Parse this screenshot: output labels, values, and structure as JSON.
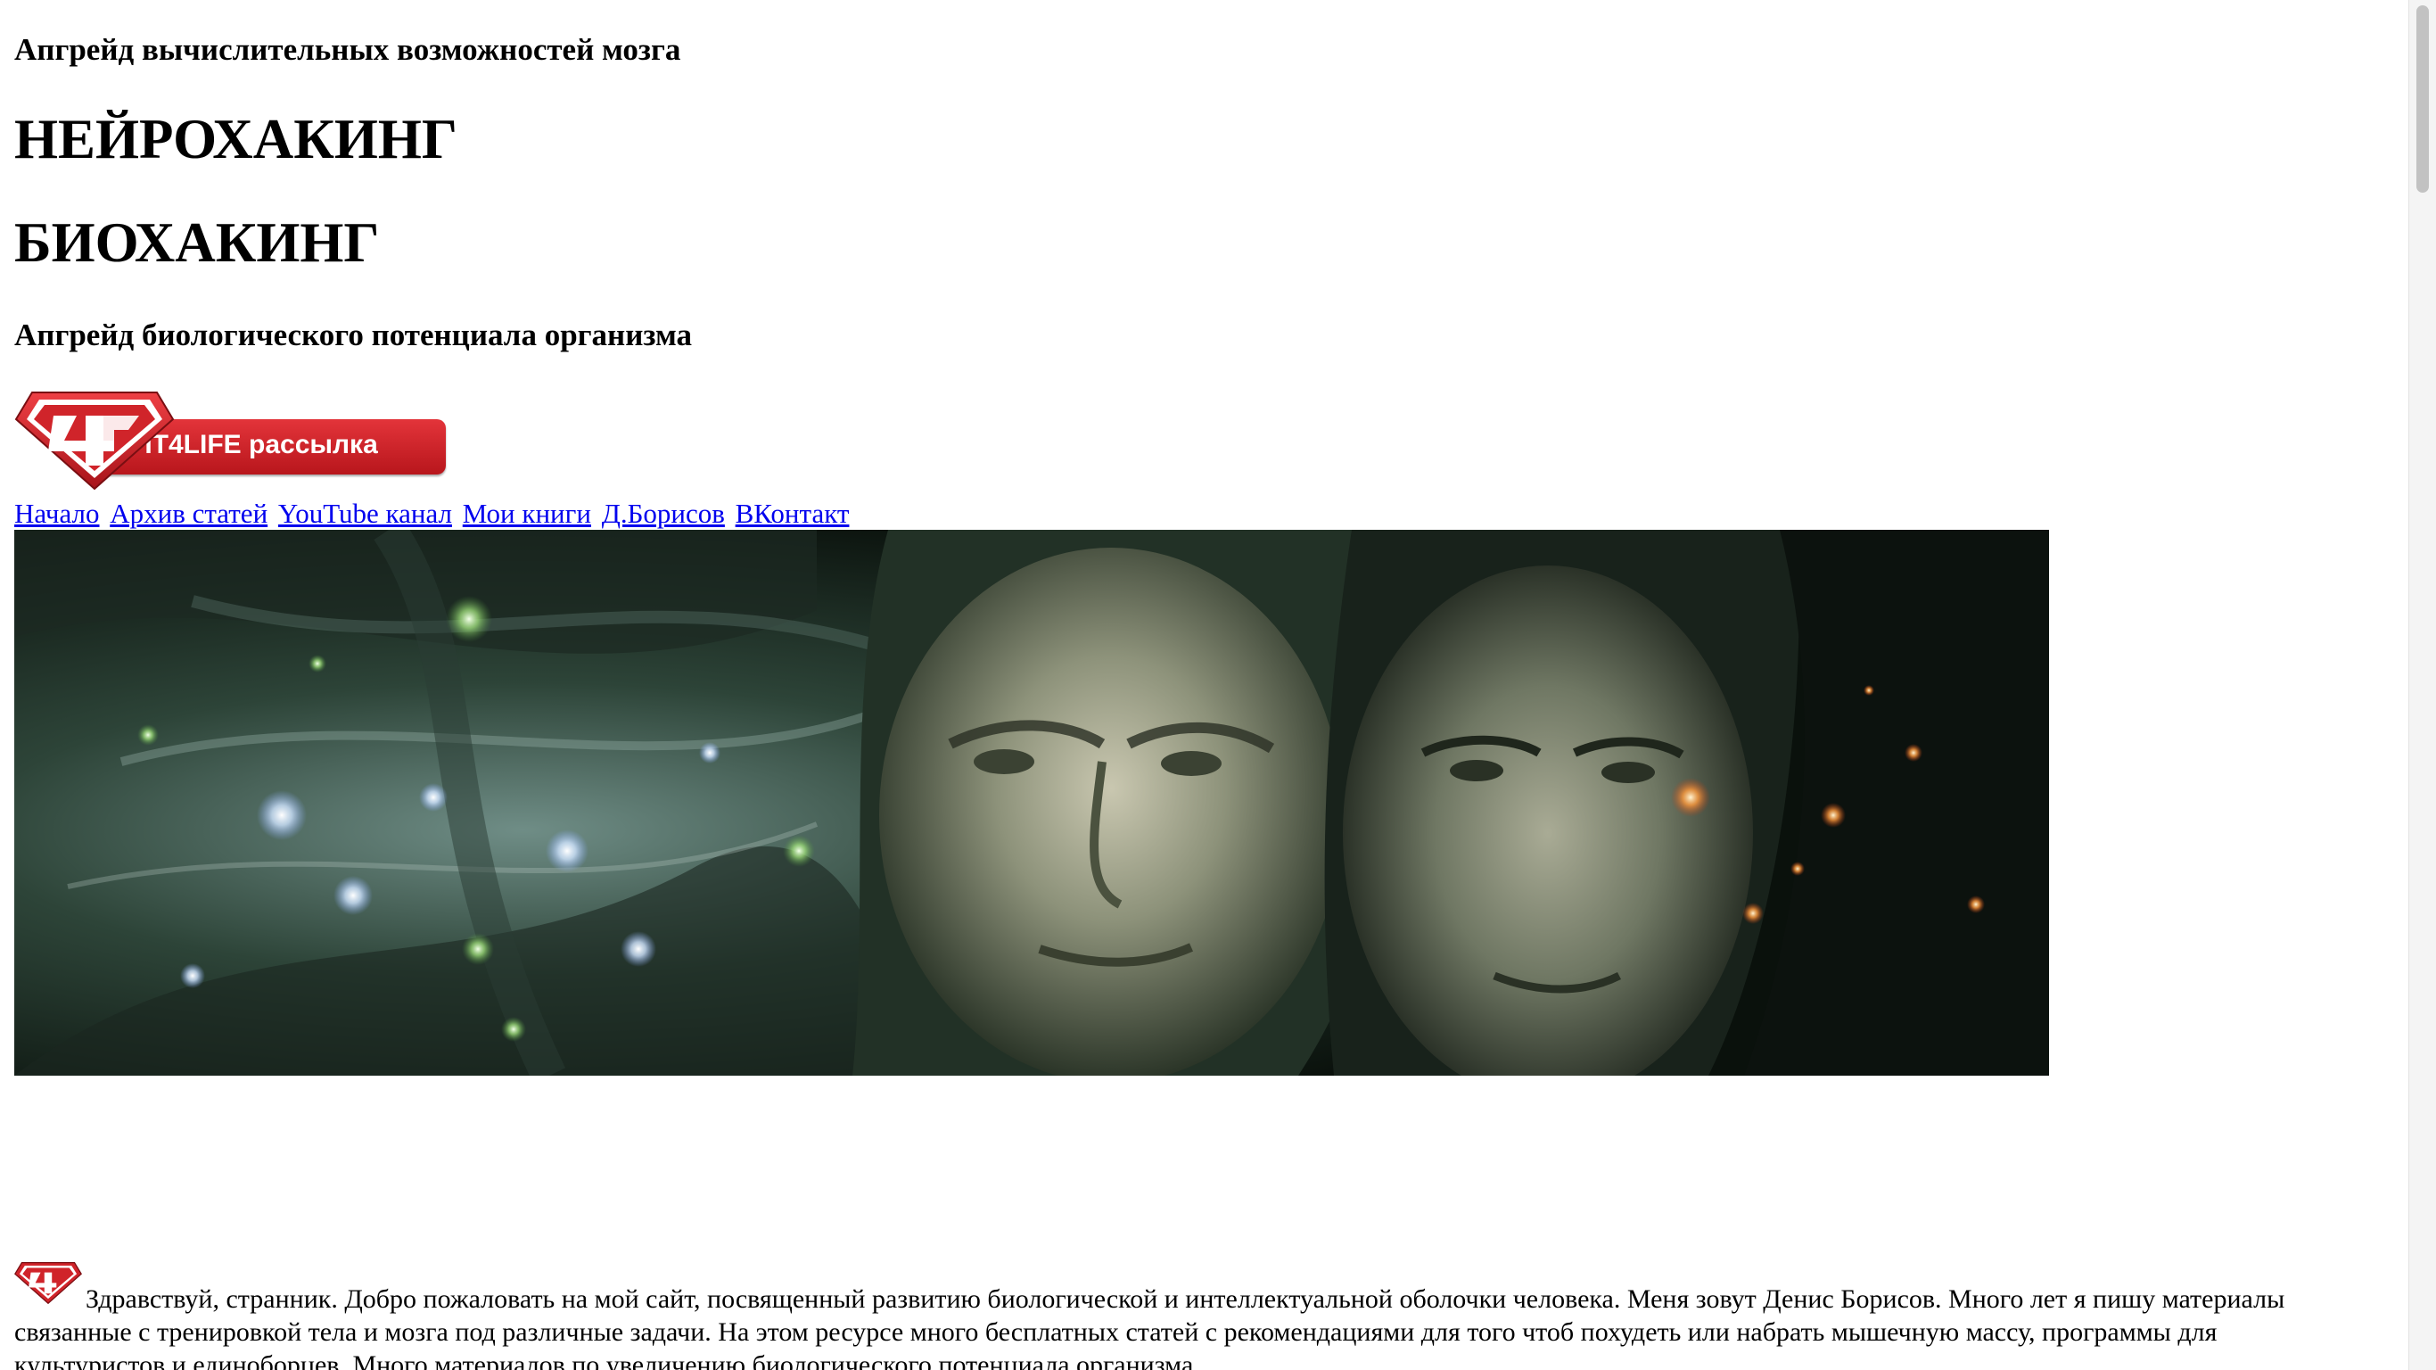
{
  "header": {
    "subtitle_top": "Апгрейд вычислительных возможностей мозга",
    "title_1": "НЕЙРОХАКИНГ",
    "title_2": "БИОХАКИНГ",
    "subtitle_bottom": "Апгрейд биологического потенциала организма"
  },
  "newsletter_banner": {
    "label": "FIT4LIFE рассылка",
    "logo_icon": "fit4life-diamond-logo-icon",
    "accent_color": "#d0242a"
  },
  "nav": {
    "items": [
      {
        "label": "Начало"
      },
      {
        "label": "Архив статей"
      },
      {
        "label": "YouTube канал"
      },
      {
        "label": "Мои книги"
      },
      {
        "label": "Д.Борисов"
      },
      {
        "label": "ВКонтакт"
      }
    ],
    "link_color": "#0000ee"
  },
  "hero": {
    "icon": "hero-banner-image",
    "description_colors": [
      "#0d1410",
      "#3d5a44",
      "#8fa68c"
    ]
  },
  "intro": {
    "logo_icon": "fit4life-mini-logo-icon",
    "text": "Здравствуй, странник. Добро пожаловать на мой сайт, посвященный развитию биологической и интеллектуальной оболочки человека. Меня зовут Денис Борисов. Много лет я пишу материалы связанные с тренировкой тела и мозга под различные задачи. На этом ресурсе много бесплатных статей с рекомендациями для того чтоб похудеть или набрать мышечную массу, программы для культуристов и единоборцев. Много материалов по увеличению биологического потенциала организма."
  }
}
